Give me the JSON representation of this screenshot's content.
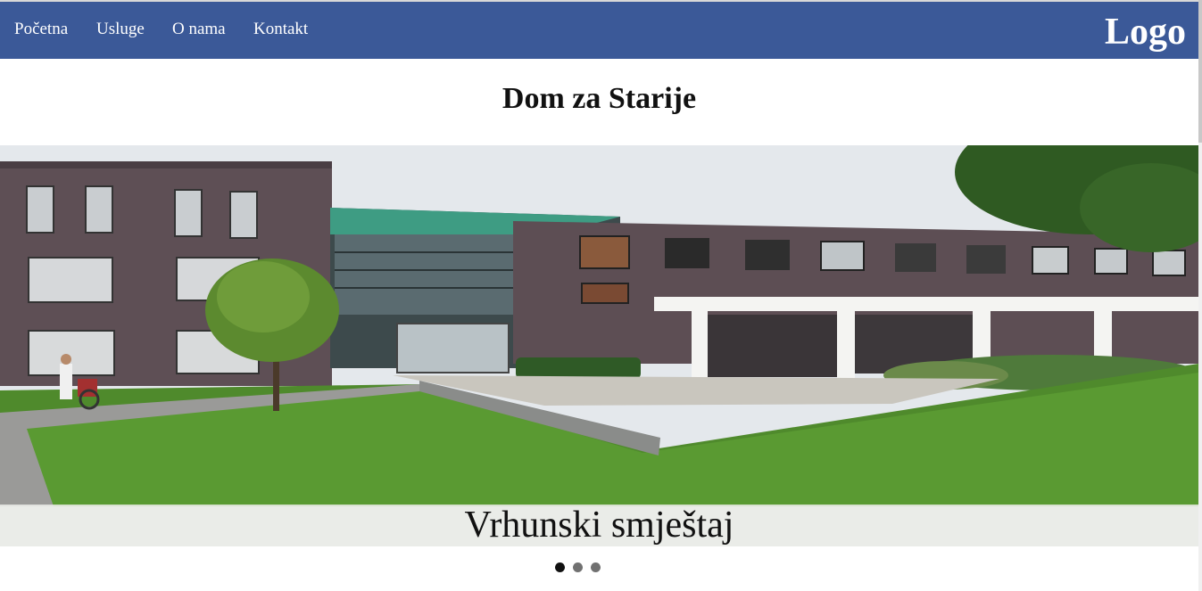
{
  "nav": {
    "items": [
      {
        "label": "Početna"
      },
      {
        "label": "Usluge"
      },
      {
        "label": "O nama"
      },
      {
        "label": "Kontakt"
      }
    ],
    "logo": "Logo",
    "color": "#3b5998"
  },
  "page": {
    "title": "Dom za Starije"
  },
  "slider": {
    "caption": "Vrhunski smještaj",
    "slide_count": 3,
    "active_index": 0
  }
}
